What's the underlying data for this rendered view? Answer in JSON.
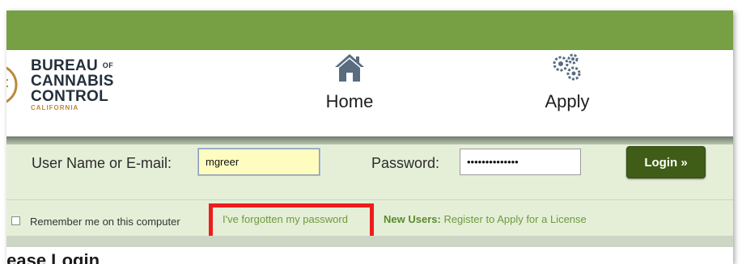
{
  "header": {
    "logo": {
      "line1": "BUREAU",
      "of": "OF",
      "line2": "CANNABIS",
      "line3": "CONTROL",
      "state": "CALIFORNIA"
    },
    "nav": [
      {
        "label": "Home",
        "icon": "home-icon"
      },
      {
        "label": "Apply",
        "icon": "gears-icon"
      }
    ]
  },
  "login": {
    "username_label": "User Name or E-mail:",
    "username_value": "mgreer",
    "password_label": "Password:",
    "password_value": "••••••••••••••",
    "login_button": "Login »"
  },
  "options": {
    "remember_label": "Remember me on this computer",
    "remember_checked": false,
    "forgot_link": "I've forgotten my password",
    "new_users_label": "New Users:",
    "register_link": "Register to Apply for a License"
  },
  "page": {
    "heading": "lease Login"
  },
  "colors": {
    "top_bar": "#76a043",
    "panel_bg": "#e5efd8",
    "login_button": "#3f5d17",
    "link": "#6e9a3c",
    "highlight": "#ee1c1c"
  }
}
